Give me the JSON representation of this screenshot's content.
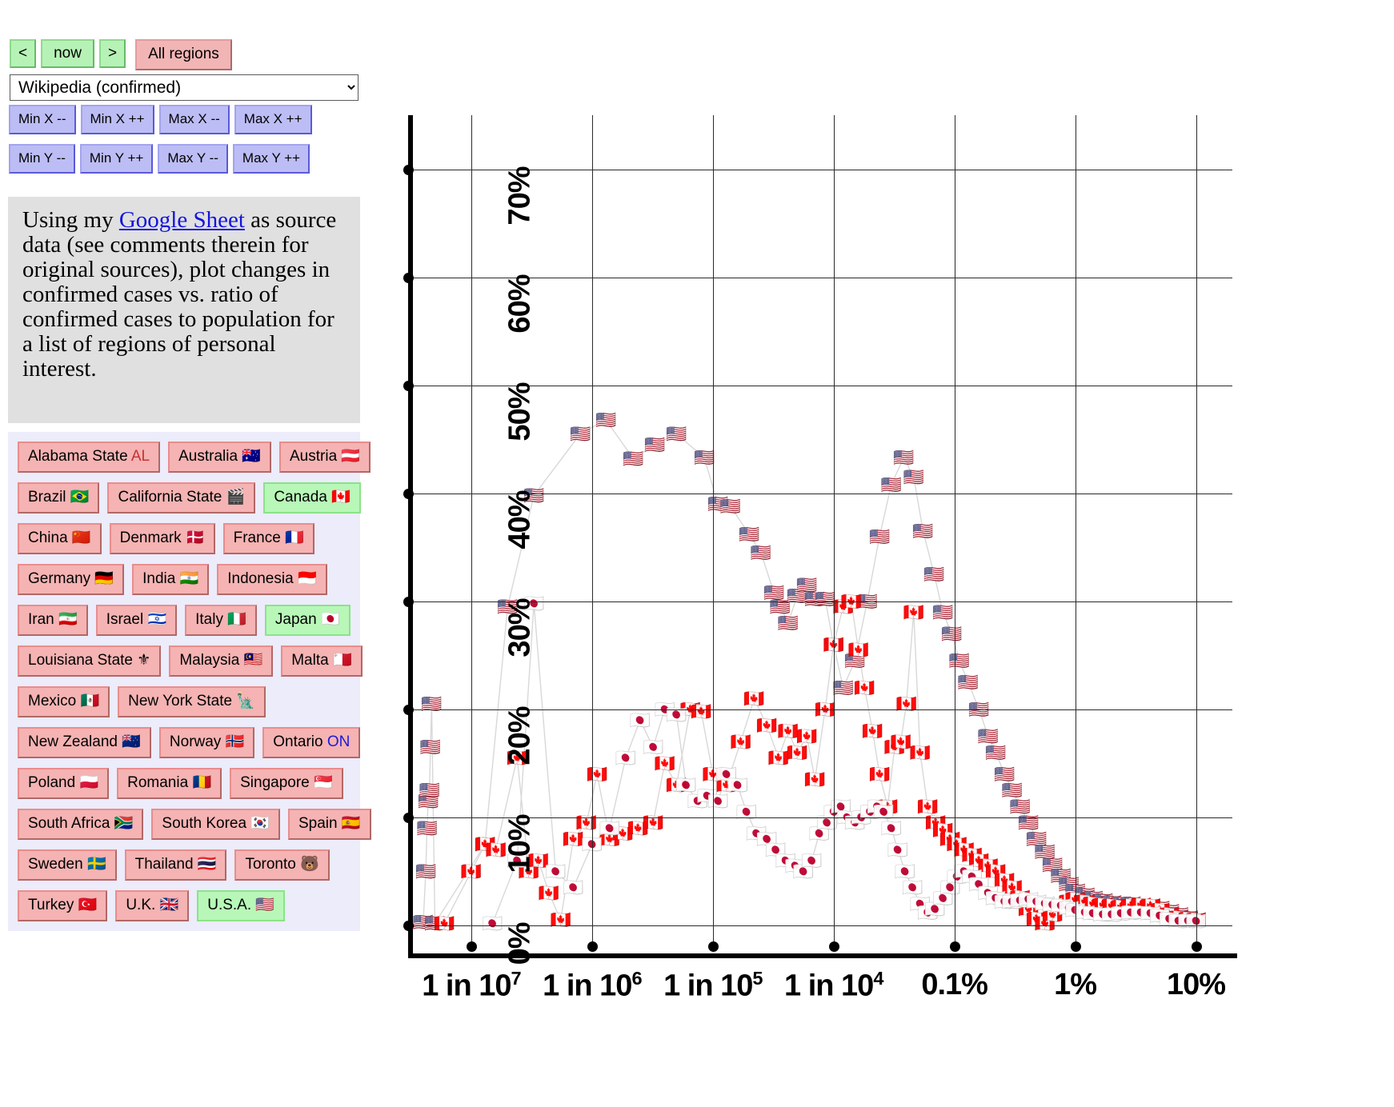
{
  "toolbar": {
    "prev_label": "<",
    "now_label": "now",
    "next_label": ">",
    "all_regions_label": "All regions",
    "source_selected": "Wikipedia (confirmed)",
    "source_options": [
      "Wikipedia (confirmed)"
    ]
  },
  "axis_controls": {
    "x": [
      "Min X --",
      "Min X ++",
      "Max X --",
      "Max X ++"
    ],
    "y": [
      "Min Y --",
      "Min Y ++",
      "Max Y --",
      "Max Y ++"
    ]
  },
  "description": {
    "lead": "Using my ",
    "link_text": "Google Sheet",
    "rest": " as source data (see comments therein for original sources), plot changes in confirmed cases vs. ratio of confirmed cases to population for a list of regions of personal interest."
  },
  "regions": [
    [
      {
        "label": "Alabama State",
        "code": "AL",
        "code_color": "#c83232",
        "flag": "",
        "selected": false
      },
      {
        "label": "Australia",
        "flag": "🇦🇺",
        "selected": false
      },
      {
        "label": "Austria",
        "flag": "🇦🇹",
        "selected": false
      }
    ],
    [
      {
        "label": "Brazil",
        "flag": "🇧🇷",
        "selected": false
      },
      {
        "label": "California State",
        "flag": "🎬",
        "selected": false
      },
      {
        "label": "Canada",
        "flag": "🇨🇦",
        "selected": true
      }
    ],
    [
      {
        "label": "China",
        "flag": "🇨🇳",
        "selected": false
      },
      {
        "label": "Denmark",
        "flag": "🇩🇰",
        "selected": false
      },
      {
        "label": "France",
        "flag": "🇫🇷",
        "selected": false
      }
    ],
    [
      {
        "label": "Germany",
        "flag": "🇩🇪",
        "selected": false
      },
      {
        "label": "India",
        "flag": "🇮🇳",
        "selected": false
      },
      {
        "label": "Indonesia",
        "flag": "🇮🇩",
        "selected": false
      }
    ],
    [
      {
        "label": "Iran",
        "flag": "🇮🇷",
        "selected": false
      },
      {
        "label": "Israel",
        "flag": "🇮🇱",
        "selected": false
      },
      {
        "label": "Italy",
        "flag": "🇮🇹",
        "selected": false
      },
      {
        "label": "Japan",
        "flag": "🇯🇵",
        "selected": true
      }
    ],
    [
      {
        "label": "Louisiana State",
        "flag": "⚜",
        "selected": false
      },
      {
        "label": "Malaysia",
        "flag": "🇲🇾",
        "selected": false
      },
      {
        "label": "Malta",
        "flag": "🇲🇹",
        "selected": false
      }
    ],
    [
      {
        "label": "Mexico",
        "flag": "🇲🇽",
        "selected": false
      },
      {
        "label": "New York State",
        "flag": "🗽",
        "selected": false
      }
    ],
    [
      {
        "label": "New Zealand",
        "flag": "🇳🇿",
        "selected": false
      },
      {
        "label": "Norway",
        "flag": "🇳🇴",
        "selected": false
      },
      {
        "label": "Ontario",
        "code": "ON",
        "code_color": "#1b1bd8",
        "flag": "",
        "selected": false
      }
    ],
    [
      {
        "label": "Poland",
        "flag": "🇵🇱",
        "selected": false
      },
      {
        "label": "Romania",
        "flag": "🇷🇴",
        "selected": false
      },
      {
        "label": "Singapore",
        "flag": "🇸🇬",
        "selected": false
      }
    ],
    [
      {
        "label": "South Africa",
        "flag": "🇿🇦",
        "selected": false
      },
      {
        "label": "South Korea",
        "flag": "🇰🇷",
        "selected": false
      },
      {
        "label": "Spain",
        "flag": "🇪🇸",
        "selected": false
      }
    ],
    [
      {
        "label": "Sweden",
        "flag": "🇸🇪",
        "selected": false
      },
      {
        "label": "Thailand",
        "flag": "🇹🇭",
        "selected": false
      },
      {
        "label": "Toronto",
        "flag": "🐻",
        "selected": false
      }
    ],
    [
      {
        "label": "Turkey",
        "flag": "🇹🇷",
        "selected": false
      },
      {
        "label": "U.K.",
        "flag": "🇬🇧",
        "selected": false
      },
      {
        "label": "U.S.A.",
        "flag": "🇺🇸",
        "selected": true
      }
    ]
  ],
  "chart_data": {
    "type": "scatter",
    "title": "",
    "xlabel": "",
    "ylabel": "",
    "x_scale": "log",
    "x_tick_labels": [
      "1 in 10⁷",
      "1 in 10⁶",
      "1 in 10⁵",
      "1 in 10⁴",
      "0.1%",
      "1%",
      "10%"
    ],
    "x_tick_values": [
      1e-07,
      1e-06,
      1e-05,
      0.0001,
      0.001,
      0.01,
      0.1
    ],
    "xlim": [
      3e-08,
      0.2
    ],
    "y_tick_labels": [
      "0%",
      "10%",
      "20%",
      "30%",
      "40%",
      "50%",
      "60%",
      "70%"
    ],
    "y_tick_values": [
      0,
      10,
      20,
      30,
      40,
      50,
      60,
      70
    ],
    "ylim": [
      -2,
      75
    ],
    "grid": true,
    "legend": "none",
    "series": [
      {
        "name": "U.S.A.",
        "marker": "🇺🇸",
        "color": "#6e8fc4",
        "points": [
          [
            4e-08,
            0.3
          ],
          [
            4.2e-08,
            5.0
          ],
          [
            4.3e-08,
            9.0
          ],
          [
            4.4e-08,
            11.5
          ],
          [
            4.5e-08,
            12.5
          ],
          [
            4.6e-08,
            16.5
          ],
          [
            4.7e-08,
            20.5
          ],
          [
            5e-08,
            0.2
          ],
          [
            1.3e-07,
            7.5
          ],
          [
            2e-07,
            29.5
          ],
          [
            3.3e-07,
            39.8
          ],
          [
            8e-07,
            45.5
          ],
          [
            1.3e-06,
            46.8
          ],
          [
            2.2e-06,
            43.2
          ],
          [
            3.3e-06,
            44.5
          ],
          [
            5e-06,
            45.5
          ],
          [
            8.5e-06,
            43.3
          ],
          [
            1.1e-05,
            39.0
          ],
          [
            1.4e-05,
            38.8
          ],
          [
            2e-05,
            36.2
          ],
          [
            2.5e-05,
            34.5
          ],
          [
            3.2e-05,
            30.8
          ],
          [
            3.6e-05,
            29.5
          ],
          [
            4.2e-05,
            28.0
          ],
          [
            5e-05,
            30.5
          ],
          [
            6e-05,
            31.5
          ],
          [
            7e-05,
            30.2
          ],
          [
            8.5e-05,
            30.2
          ],
          [
            0.0001,
            26.0
          ],
          [
            0.00012,
            22.0
          ],
          [
            0.00015,
            24.5
          ],
          [
            0.00019,
            30.0
          ],
          [
            0.00024,
            36.0
          ],
          [
            0.0003,
            40.8
          ],
          [
            0.00038,
            43.3
          ],
          [
            0.00046,
            41.5
          ],
          [
            0.00055,
            36.5
          ],
          [
            0.00068,
            32.5
          ],
          [
            0.0008,
            29.0
          ],
          [
            0.00095,
            27.0
          ],
          [
            0.0011,
            24.5
          ],
          [
            0.0013,
            22.5
          ],
          [
            0.0016,
            20.0
          ],
          [
            0.0019,
            17.5
          ],
          [
            0.0022,
            16.0
          ],
          [
            0.0026,
            14.0
          ],
          [
            0.003,
            12.5
          ],
          [
            0.0035,
            11.0
          ],
          [
            0.0041,
            9.5
          ],
          [
            0.0048,
            8.0
          ],
          [
            0.0056,
            6.8
          ],
          [
            0.0065,
            5.6
          ],
          [
            0.0076,
            4.6
          ],
          [
            0.0089,
            3.8
          ],
          [
            0.01,
            3.2
          ],
          [
            0.012,
            2.8
          ],
          [
            0.014,
            2.5
          ],
          [
            0.017,
            2.3
          ],
          [
            0.02,
            2.1
          ],
          [
            0.024,
            2.0
          ],
          [
            0.029,
            2.0
          ],
          [
            0.035,
            1.9
          ],
          [
            0.042,
            1.8
          ],
          [
            0.05,
            1.6
          ],
          [
            0.06,
            1.3
          ],
          [
            0.072,
            1.0
          ],
          [
            0.086,
            0.7
          ],
          [
            0.1,
            0.5
          ]
        ]
      },
      {
        "name": "Canada",
        "marker": "🇨🇦",
        "color": "#e06060",
        "points": [
          [
            6e-08,
            0.2
          ],
          [
            1e-07,
            5.0
          ],
          [
            1.3e-07,
            7.5
          ],
          [
            1.6e-07,
            7.0
          ],
          [
            2.4e-07,
            15.5
          ],
          [
            3e-07,
            5.0
          ],
          [
            3.6e-07,
            6.0
          ],
          [
            4.4e-07,
            3.0
          ],
          [
            5.5e-07,
            0.5
          ],
          [
            7e-07,
            8.0
          ],
          [
            9e-07,
            9.5
          ],
          [
            1.1e-06,
            14.0
          ],
          [
            1.4e-06,
            8.0
          ],
          [
            1.8e-06,
            8.5
          ],
          [
            2.4e-06,
            9.0
          ],
          [
            3.2e-06,
            9.5
          ],
          [
            4e-06,
            15.0
          ],
          [
            5e-06,
            13.0
          ],
          [
            6.5e-06,
            20.0
          ],
          [
            8e-06,
            19.8
          ],
          [
            1e-05,
            14.0
          ],
          [
            1.3e-05,
            13.0
          ],
          [
            1.7e-05,
            17.0
          ],
          [
            2.2e-05,
            21.0
          ],
          [
            2.8e-05,
            18.5
          ],
          [
            3.5e-05,
            15.5
          ],
          [
            4.2e-05,
            18.0
          ],
          [
            5e-05,
            16.0
          ],
          [
            6e-05,
            17.5
          ],
          [
            7e-05,
            13.5
          ],
          [
            8.5e-05,
            20.0
          ],
          [
            0.0001,
            26.0
          ],
          [
            0.00012,
            29.5
          ],
          [
            0.00014,
            30.0
          ],
          [
            0.00016,
            25.5
          ],
          [
            0.00018,
            22.0
          ],
          [
            0.00021,
            18.0
          ],
          [
            0.00024,
            14.0
          ],
          [
            0.00028,
            11.0
          ],
          [
            0.00032,
            16.5
          ],
          [
            0.00036,
            17.0
          ],
          [
            0.0004,
            20.5
          ],
          [
            0.00046,
            29.0
          ],
          [
            0.00052,
            16.0
          ],
          [
            0.0006,
            11.0
          ],
          [
            0.0007,
            9.5
          ],
          [
            0.0008,
            8.8
          ],
          [
            0.00092,
            8.0
          ],
          [
            0.00105,
            7.5
          ],
          [
            0.0012,
            7.0
          ],
          [
            0.0014,
            6.5
          ],
          [
            0.0016,
            6.0
          ],
          [
            0.0019,
            5.5
          ],
          [
            0.0022,
            5.0
          ],
          [
            0.0026,
            4.2
          ],
          [
            0.003,
            3.5
          ],
          [
            0.0035,
            2.6
          ],
          [
            0.0041,
            1.5
          ],
          [
            0.0048,
            0.6
          ],
          [
            0.0056,
            0.2
          ],
          [
            0.0065,
            1.0
          ],
          [
            0.0076,
            1.8
          ],
          [
            0.0089,
            2.2
          ],
          [
            0.01,
            2.4
          ],
          [
            0.012,
            2.2
          ],
          [
            0.014,
            2.0
          ],
          [
            0.017,
            1.9
          ],
          [
            0.02,
            1.8
          ],
          [
            0.024,
            1.7
          ],
          [
            0.029,
            1.8
          ],
          [
            0.035,
            1.9
          ],
          [
            0.042,
            1.8
          ],
          [
            0.05,
            1.4
          ],
          [
            0.06,
            1.0
          ],
          [
            0.072,
            0.7
          ],
          [
            0.086,
            0.6
          ],
          [
            0.1,
            0.5
          ]
        ]
      },
      {
        "name": "Japan",
        "marker": "🇯🇵",
        "color": "#d8a0a8",
        "points": [
          [
            1.5e-07,
            0.2
          ],
          [
            2.4e-07,
            6.0
          ],
          [
            3.3e-07,
            29.8
          ],
          [
            5e-07,
            5.0
          ],
          [
            7e-07,
            3.5
          ],
          [
            1e-06,
            7.5
          ],
          [
            1.4e-06,
            9.0
          ],
          [
            1.9e-06,
            15.5
          ],
          [
            2.5e-06,
            19.0
          ],
          [
            3.2e-06,
            16.5
          ],
          [
            4e-06,
            20.0
          ],
          [
            5e-06,
            19.5
          ],
          [
            6e-06,
            13.0
          ],
          [
            7.5e-06,
            11.5
          ],
          [
            9e-06,
            12.0
          ],
          [
            1.1e-05,
            11.5
          ],
          [
            1.3e-05,
            14.0
          ],
          [
            1.6e-05,
            13.0
          ],
          [
            1.9e-05,
            10.5
          ],
          [
            2.3e-05,
            8.5
          ],
          [
            2.8e-05,
            8.0
          ],
          [
            3.3e-05,
            7.0
          ],
          [
            4e-05,
            6.0
          ],
          [
            4.8e-05,
            5.5
          ],
          [
            5.6e-05,
            5.0
          ],
          [
            6.6e-05,
            6.0
          ],
          [
            7.6e-05,
            8.5
          ],
          [
            8.8e-05,
            9.5
          ],
          [
            0.0001,
            10.5
          ],
          [
            0.000115,
            11.0
          ],
          [
            0.00013,
            10.0
          ],
          [
            0.00015,
            9.5
          ],
          [
            0.00017,
            10.0
          ],
          [
            0.0002,
            10.5
          ],
          [
            0.00023,
            11.0
          ],
          [
            0.00026,
            10.5
          ],
          [
            0.0003,
            9.0
          ],
          [
            0.00034,
            7.0
          ],
          [
            0.00039,
            5.0
          ],
          [
            0.00045,
            3.5
          ],
          [
            0.00052,
            2.0
          ],
          [
            0.0006,
            1.2
          ],
          [
            0.00069,
            1.5
          ],
          [
            0.0008,
            2.5
          ],
          [
            0.00092,
            3.5
          ],
          [
            0.00105,
            4.5
          ],
          [
            0.0012,
            5.0
          ],
          [
            0.0014,
            4.5
          ],
          [
            0.0016,
            3.8
          ],
          [
            0.0019,
            3.0
          ],
          [
            0.0022,
            2.5
          ],
          [
            0.0026,
            2.2
          ],
          [
            0.003,
            2.2
          ],
          [
            0.0035,
            2.3
          ],
          [
            0.0041,
            2.4
          ],
          [
            0.0048,
            2.2
          ],
          [
            0.0056,
            2.0
          ],
          [
            0.0065,
            1.9
          ],
          [
            0.0076,
            1.8
          ],
          [
            0.0089,
            1.6
          ],
          [
            0.01,
            1.4
          ],
          [
            0.012,
            1.2
          ],
          [
            0.014,
            1.1
          ],
          [
            0.017,
            1.0
          ],
          [
            0.02,
            1.0
          ],
          [
            0.024,
            1.1
          ],
          [
            0.029,
            1.2
          ],
          [
            0.035,
            1.2
          ],
          [
            0.042,
            1.1
          ],
          [
            0.05,
            0.9
          ],
          [
            0.06,
            0.6
          ],
          [
            0.072,
            0.4
          ],
          [
            0.086,
            0.4
          ],
          [
            0.1,
            0.4
          ]
        ]
      }
    ]
  }
}
